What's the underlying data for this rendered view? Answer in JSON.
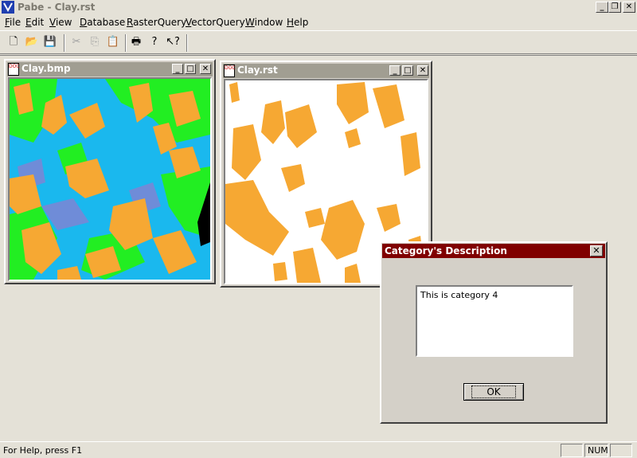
{
  "app": {
    "title": "Pabe - Clay.rst",
    "controls": {
      "minimize": "_",
      "restore": "❐",
      "close": "✕"
    }
  },
  "menu": [
    "File",
    "Edit",
    "View",
    "Database",
    "RasterQuery",
    "VectorQuery",
    "Window",
    "Help"
  ],
  "toolbar": [
    {
      "name": "new-file-icon",
      "glyph": "🗋",
      "enabled": true
    },
    {
      "name": "open-folder-icon",
      "glyph": "📂",
      "enabled": true
    },
    {
      "name": "save-icon",
      "glyph": "💾",
      "enabled": true
    },
    {
      "name": "cut-icon",
      "glyph": "✂",
      "enabled": false
    },
    {
      "name": "copy-icon",
      "glyph": "⎘",
      "enabled": false
    },
    {
      "name": "paste-icon",
      "glyph": "📋",
      "enabled": false
    },
    {
      "name": "print-icon",
      "glyph": "🖶",
      "enabled": true
    },
    {
      "name": "help-icon",
      "glyph": "?",
      "enabled": true
    },
    {
      "name": "context-help-icon",
      "glyph": "↖?",
      "enabled": true
    }
  ],
  "windows": {
    "clay_bmp": {
      "title": "Clay.bmp"
    },
    "clay_rst": {
      "title": "Clay.rst"
    }
  },
  "dialog": {
    "title": "Category's Description",
    "description": "This is category 4",
    "ok_label": "OK",
    "close": "✕"
  },
  "statusbar": {
    "help_text": "For Help, press F1",
    "num": "NUM"
  },
  "colors": {
    "category_orange": "#f6a833",
    "water_blue": "#1ab8ee",
    "vegetation_green": "#22ee22",
    "dialog_title": "#800000",
    "child_title_inactive": "#a19e92"
  }
}
